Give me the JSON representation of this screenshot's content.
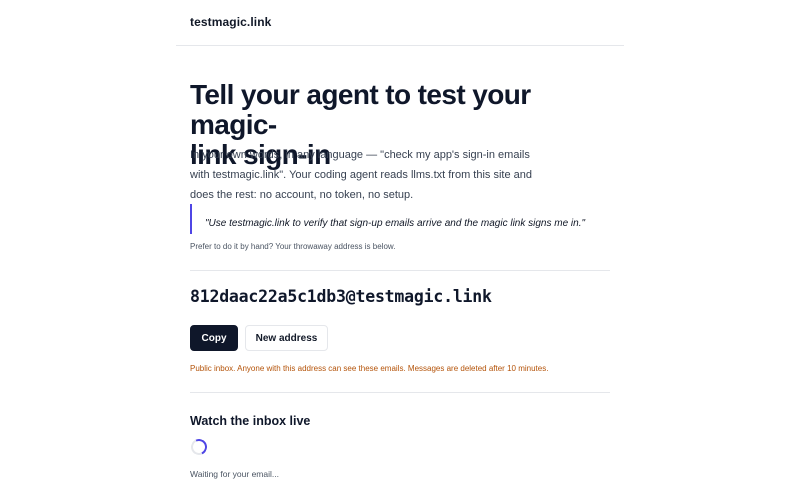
{
  "header": {
    "brand": "testmagic.link"
  },
  "hero": {
    "headline_line1": "Tell your agent to test your magic-",
    "headline_line2": "link sign-in",
    "intro_line1": "In your own words, in any language — \"check my app's sign-in emails",
    "intro_line2": "with testmagic.link\". Your coding agent reads llms.txt from this site and",
    "intro_line3": "does the rest: no account, no token, no setup.",
    "quote": "\"Use testmagic.link to verify that sign-up emails arrive and the magic link signs me in.\"",
    "hint": "Prefer to do it by hand? Your throwaway address is below."
  },
  "inbox": {
    "address": "812daac22a5c1db3@testmagic.link",
    "copy_label": "Copy",
    "new_address_label": "New address",
    "warning": "Public inbox. Anyone with this address can see these emails. Messages are deleted after 10 minutes."
  },
  "live": {
    "title": "Watch the inbox live",
    "status": "Waiting for your email..."
  },
  "colors": {
    "accent": "#4f46e5",
    "primary_button": "#0f172a",
    "warning_text": "#b45309"
  },
  "icons": {
    "spinner": "loading-spinner-icon"
  }
}
